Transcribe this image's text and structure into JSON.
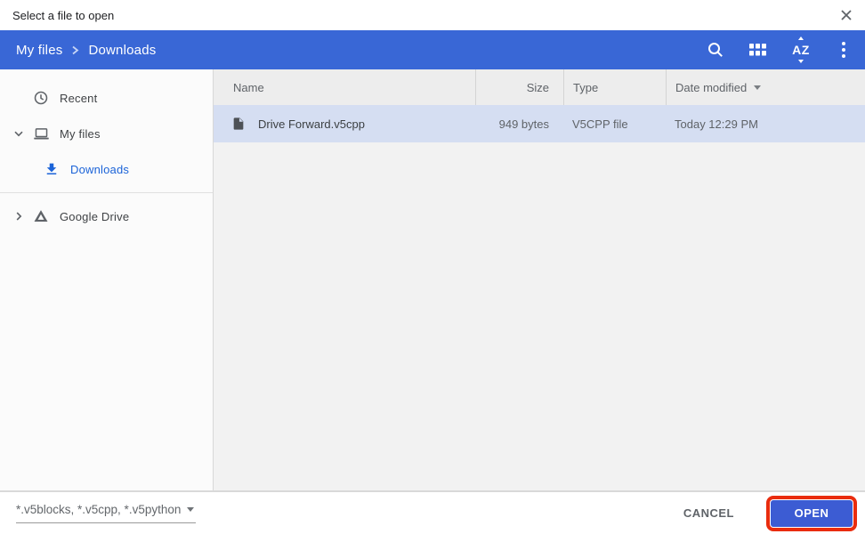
{
  "window": {
    "title": "Select a file to open"
  },
  "toolbar": {
    "breadcrumbs": [
      {
        "label": "My files"
      },
      {
        "label": "Downloads"
      }
    ],
    "sort_icon_text": "AZ",
    "icons": [
      "search",
      "grid-view",
      "sort-az",
      "more-menu"
    ]
  },
  "sidebar": {
    "items": [
      {
        "label": "Recent",
        "icon": "clock",
        "selected": false
      },
      {
        "label": "My files",
        "icon": "laptop",
        "expanded": true,
        "selected": false
      },
      {
        "label": "Downloads",
        "icon": "download",
        "selected": true
      },
      {
        "label": "Google Drive",
        "icon": "google-drive",
        "expanded": false,
        "selected": false
      }
    ]
  },
  "table": {
    "columns": [
      {
        "label": "Name"
      },
      {
        "label": "Size"
      },
      {
        "label": "Type"
      },
      {
        "label": "Date modified",
        "sorted": "desc"
      }
    ],
    "rows": [
      {
        "name": "Drive Forward.v5cpp",
        "size": "949 bytes",
        "type": "V5CPP file",
        "date_modified": "Today 12:29 PM",
        "selected": true
      }
    ]
  },
  "footer": {
    "file_filter": "*.v5blocks, *.v5cpp, *.v5python",
    "cancel_label": "CANCEL",
    "open_label": "OPEN"
  },
  "colors": {
    "toolbar_blue": "#3967d6",
    "open_button_blue": "#3c5cd3",
    "selected_row_blue": "#d5def2",
    "accent_link_blue": "#1b63d8",
    "highlight_red": "#e92c0e",
    "header_gray": "#ededed",
    "list_background": "#f2f2f2"
  }
}
